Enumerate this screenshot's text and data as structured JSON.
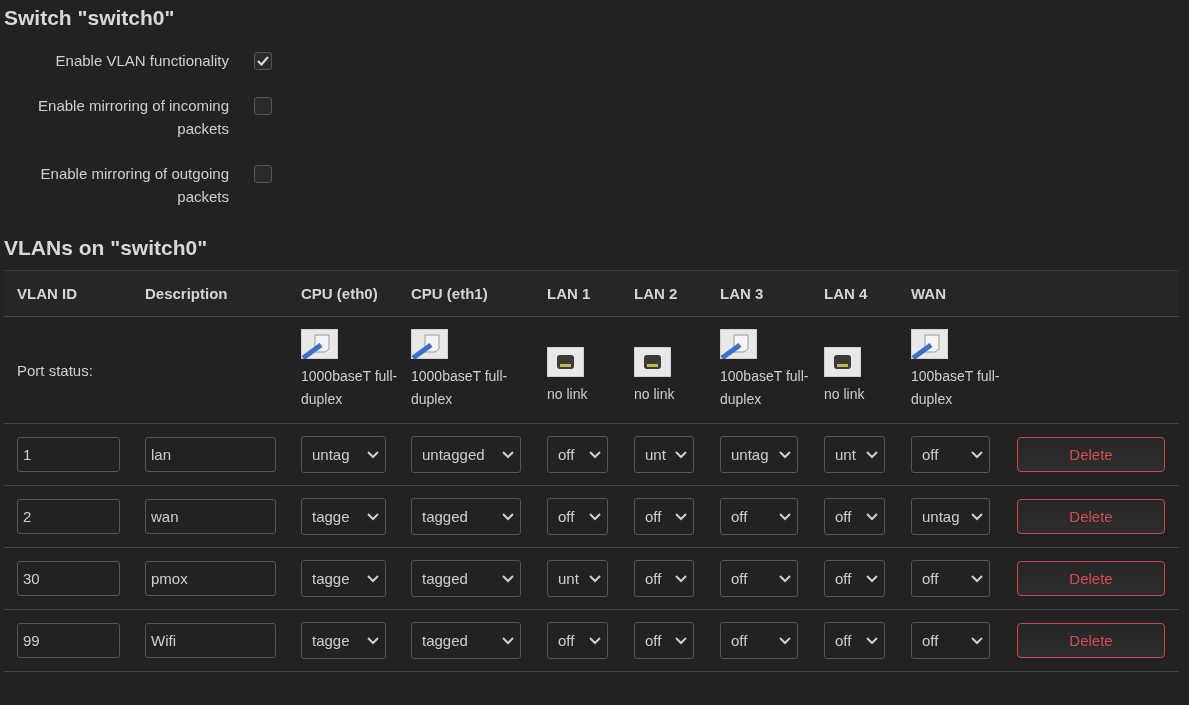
{
  "switch_section": {
    "title": "Switch \"switch0\"",
    "options": [
      {
        "label": "Enable VLAN functionality",
        "checked": true
      },
      {
        "label": "Enable mirroring of incoming packets",
        "checked": false
      },
      {
        "label": "Enable mirroring of outgoing packets",
        "checked": false
      }
    ]
  },
  "vlans_section": {
    "title": "VLANs on \"switch0\"",
    "columns": [
      "VLAN ID",
      "Description",
      "CPU (eth0)",
      "CPU (eth1)",
      "LAN 1",
      "LAN 2",
      "LAN 3",
      "LAN 4",
      "WAN"
    ],
    "port_status": {
      "label": "Port status:",
      "ports": [
        {
          "kind": "linked",
          "text": "1000baseT full-duplex"
        },
        {
          "kind": "linked",
          "text": "1000baseT full-duplex"
        },
        {
          "kind": "nolink",
          "text": "no link"
        },
        {
          "kind": "nolink",
          "text": "no link"
        },
        {
          "kind": "linked",
          "text": "100baseT full-duplex"
        },
        {
          "kind": "nolink",
          "text": "no link"
        },
        {
          "kind": "linked",
          "text": "100baseT full-duplex"
        }
      ]
    },
    "rows": [
      {
        "vlan_id": "1",
        "description": "lan",
        "ports": [
          "untag",
          "untagged",
          "off",
          "unt",
          "untag",
          "unt",
          "off"
        ],
        "action": "Delete"
      },
      {
        "vlan_id": "2",
        "description": "wan",
        "ports": [
          "tagge",
          "tagged",
          "off",
          "off",
          "off",
          "off",
          "untag"
        ],
        "action": "Delete"
      },
      {
        "vlan_id": "30",
        "description": "pmox",
        "ports": [
          "tagge",
          "tagged",
          "unt",
          "off",
          "off",
          "off",
          "off"
        ],
        "action": "Delete"
      },
      {
        "vlan_id": "99",
        "description": "Wifi",
        "ports": [
          "tagge",
          "tagged",
          "off",
          "off",
          "off",
          "off",
          "off"
        ],
        "action": "Delete"
      }
    ]
  }
}
